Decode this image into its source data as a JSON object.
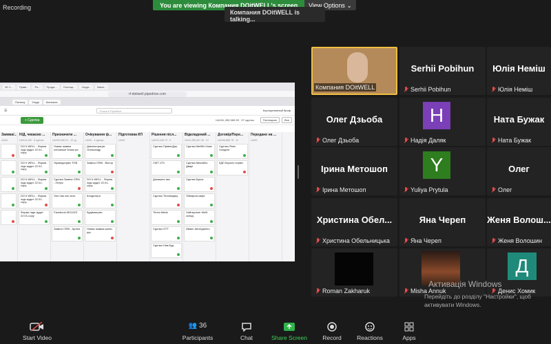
{
  "recording_label": "Recording",
  "banner": "You are viewing Компания DOitWELL's screen",
  "view_options": "View Options",
  "talking": "Компания DOitWELL is talking...",
  "share": {
    "url": "rf-doitwell.pipedrive.com",
    "search_placeholder": "Поиск в Pipedrive",
    "user": "Корпоративный бриф",
    "new_deal": "+ Сделка",
    "summary": "UAH11,289,365.35 · 97 сделок",
    "filter": "Потенциал",
    "all": "Все",
    "columns": [
      {
        "title": "Заявка/...",
        "sub": "UAH0"
      },
      {
        "title": "Н/Д, чекаємо ...",
        "sub": "UAH14,430 · 8 сделок"
      },
      {
        "title": "Призначити ...",
        "sub": "UAH30,066.24 · 10 сд"
      },
      {
        "title": "Очікування ф...",
        "sub": "UAH0 · 4 сделки"
      },
      {
        "title": "Підготовка КП",
        "sub": "UAH0"
      },
      {
        "title": "Рішення післ...",
        "sub": "UAH10,449.73 · 6"
      },
      {
        "title": "Відкладений ...",
        "sub": "UAH1,285,267.46 · 12"
      },
      {
        "title": "Договір/Пере...",
        "sub": "UAH46,885.78 · 12"
      },
      {
        "title": "Передано на ...",
        "sub": "UAH0"
      }
    ],
    "cards": [
      [
        "",
        "",
        "",
        "",
        ""
      ],
      [
        "DO It WELL - Форма ліди аудит 22.01-copy",
        "DO It WELL - Форма ліди аудит 22.01-copy",
        "DO It WELL - Форма ліди аудит 22.01-copy",
        "DO It WELL - Форма ліди аудит 22.01-copy",
        "Форма ліди аудит 22.01-copy"
      ],
      [
        "Новая заявка основные блоки ри",
        "Укрмедсервіс ТОВ",
        "Сделка Заміна CRM - Петря",
        "Опп has ww сель",
        "Facebook 8011323",
        "Заміна CRM - Артем"
      ],
      [
        "Демонстрація: Олександр",
        "Заміна CRM - Віктор",
        "DO It WELL - Форма ліди аудит 22.01-copy",
        "Кондитери",
        "Будівництво",
        "Новая заявка шагес рус"
      ],
      [],
      [
        "Сделка ПриватДор",
        "СМТ LTD",
        "Домашня їжа",
        "Сделка Телемедиці",
        "Тента Metal",
        "Сделка ОТТ",
        "Сделка Нов-Буд"
      ],
      [
        "Сделка Мейбл Нова",
        "Сделка Михайло Дварі",
        "Сделка Букса",
        "Обмарна кафе",
        "Хайтерлинг Мобі склад",
        "Иваис Автоїдаліно"
      ],
      [
        "Сделка Ялис Холдинг",
        "КДЛ Коралл сервіс"
      ],
      []
    ]
  },
  "participants": [
    {
      "name": "Компания DOitWELL",
      "big": ""
    },
    {
      "name": "Serhii Pobihun",
      "big": "Serhii Pobihun"
    },
    {
      "name": "Юлія Неміш",
      "big": "Юлія Неміш"
    },
    {
      "name": "Олег Дзьоба",
      "big": "Олег Дзьоба"
    },
    {
      "name": "Надія Даляк",
      "big": "H",
      "color": "#7b3fb8"
    },
    {
      "name": "Ната Бужак",
      "big": "Ната Бужак"
    },
    {
      "name": "Ірина Метошоп",
      "big": "Ірина Метошоп"
    },
    {
      "name": "Yuliya Prytula",
      "big": "Y",
      "color": "#2e7d1f"
    },
    {
      "name": "Олег",
      "big": "Олег"
    },
    {
      "name": "Христина Обельницька",
      "big": "Христина  Обел..."
    },
    {
      "name": "Яна Череп",
      "big": "Яна Череп"
    },
    {
      "name": "Женя Волошин",
      "big": "Женя Волош..."
    },
    {
      "name": "Roman Zakharuk",
      "big": ""
    },
    {
      "name": "Misha Annuk",
      "big": ""
    },
    {
      "name": "Денис Хомик",
      "big": "Д",
      "color": "#1f8a7a"
    }
  ],
  "watermark": {
    "title": "Активація Windows",
    "text": "Перейдіть до розділу \"Настройки\", щоб активувати Windows."
  },
  "toolbar": {
    "start_video": "Start Video",
    "participants": "Participants",
    "participants_count": "36",
    "chat": "Chat",
    "share_screen": "Share Screen",
    "record": "Record",
    "reactions": "Reactions",
    "apps": "Apps"
  }
}
